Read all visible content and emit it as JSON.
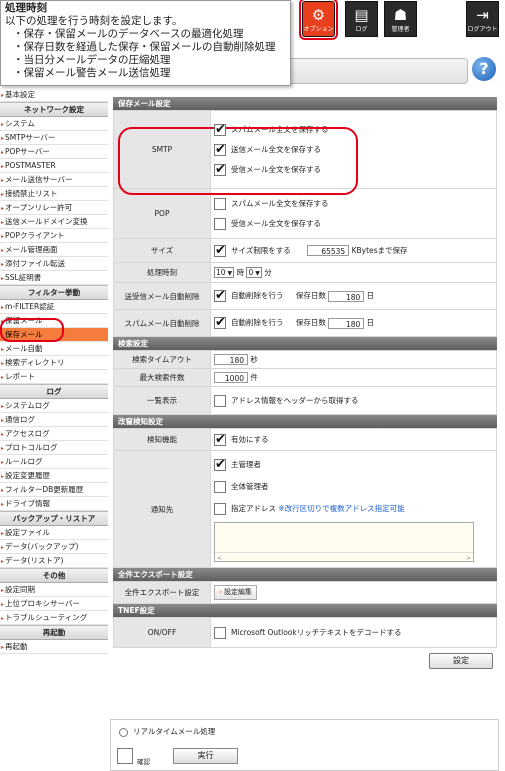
{
  "tooltip": {
    "title": "処理時刻",
    "description": "以下の処理を行う時刻を設定します。",
    "items": [
      "・保存・保留メールのデータベースの最適化処理",
      "・保存日数を経過した保存・保留メールの自動削除処理",
      "・当日分メールデータの圧縮処理",
      "・保留メール警告メール送信処理"
    ]
  },
  "topbar": {
    "buttons": [
      {
        "label": "オプション",
        "icon": "gear-icon"
      },
      {
        "label": "ログ",
        "icon": "log-icon"
      },
      {
        "label": "管理者",
        "icon": "admin-icon"
      },
      {
        "label": "ログアウト",
        "icon": "logout-icon"
      }
    ],
    "help_glyph": "?"
  },
  "sidebar": {
    "top_item": "基本設定",
    "groups": [
      {
        "title": "ネットワーク設定",
        "items": [
          "システム",
          "SMTPサーバー",
          "POPサーバー",
          "POSTMASTER",
          "メール送信サーバー",
          "接続禁止リスト",
          "オープンリレー許可",
          "送信メールドメイン変換",
          "POPクライアント",
          "メール管理画面",
          "添付ファイル転送",
          "SSL証明書"
        ]
      },
      {
        "title": "フィルター挙動",
        "items": [
          "m-FILTER認証",
          "保留メール",
          "保存メール",
          "メール自動",
          "検索ディレクトリ",
          "レポート"
        ]
      },
      {
        "title": "ログ",
        "items": [
          "システムログ",
          "通信ログ",
          "アクセスログ",
          "プロトコルログ",
          "ルールログ",
          "設定変更履歴",
          "フィルターDB更新履歴",
          "ドライブ情報"
        ]
      },
      {
        "title": "バックアップ・リストア",
        "items": [
          "設定ファイル",
          "データ(バックアップ)",
          "データ(リストア)"
        ]
      },
      {
        "title": "その他",
        "items": [
          "設定同期",
          "上位プロキシサーバー",
          "トラブルシューティング"
        ]
      },
      {
        "title": "再起動",
        "items": [
          "再起動"
        ]
      }
    ],
    "selected": "保存メール"
  },
  "main": {
    "sec_save": "保存メール設定",
    "smtp_label": "SMTP",
    "smtp_opts": [
      {
        "label": "スパムメール全文を保存する",
        "checked": true
      },
      {
        "label": "送信メール全文を保存する",
        "checked": true
      },
      {
        "label": "受信メール全文を保存する",
        "checked": true
      }
    ],
    "pop_label": "POP",
    "pop_opts": [
      {
        "label": "スパムメール全文を保存する",
        "checked": false
      },
      {
        "label": "受信メール全文を保存する",
        "checked": false
      }
    ],
    "size_label": "サイズ",
    "size_opt": "サイズ制限をする",
    "size_value": "65535",
    "size_unit": "KBytesまで保存",
    "time_label": "処理時刻",
    "time_hour": "10",
    "time_hour_unit": "時",
    "time_min": "0",
    "time_min_unit": "分",
    "sr_label": "送受信メール自動削除",
    "sr_opt": "自動削除を行う",
    "sr_days_label": "保存日数",
    "sr_days": "180",
    "sr_days_unit": "日",
    "spam_label": "スパムメール自動削除",
    "spam_opt": "自動削除を行う",
    "spam_days_label": "保存日数",
    "spam_days": "180",
    "spam_days_unit": "日",
    "sec_search": "検索設定",
    "timeout_label": "検索タイムアウト",
    "timeout_value": "180",
    "timeout_unit": "秒",
    "maxres_label": "最大検索件数",
    "maxres_value": "1000",
    "maxres_unit": "件",
    "list_label": "一覧表示",
    "list_opt": "アドレス情報をヘッダーから取得する",
    "sec_tamper": "改竄検知設定",
    "detect_label": "検知機能",
    "detect_opt": "有効にする",
    "notify_label": "通知先",
    "notify_opts": [
      {
        "label": "主管理者",
        "checked": true
      },
      {
        "label": "全体管理者",
        "checked": false
      },
      {
        "label": "指定アドレス",
        "checked": false
      }
    ],
    "notify_hint": "※改行区切りで複数アドレス指定可能",
    "sec_export": "全件エクスポート設定",
    "export_label": "全件エクスポート設定",
    "export_btn": "設定編集",
    "sec_tnef": "TNEF設定",
    "onoff_label": "ON/OFF",
    "tnef_opt": "Microsoft Outlookリッチテキストをデコードする",
    "save_btn": "設定"
  },
  "bottom": {
    "radio_label": "リアルタイムメール処理",
    "check_label": "確認",
    "run_btn": "実行"
  }
}
